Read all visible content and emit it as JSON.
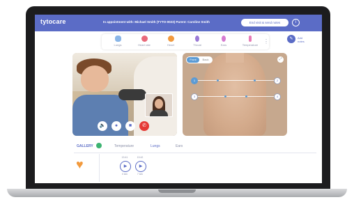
{
  "app": {
    "logo": "tytocare",
    "appointment_text": "In appointment with: Michael Smith (TYTO-0023)  Parent: Caroline Smith",
    "end_button": "End visit & send notes",
    "info_icon": "info-icon"
  },
  "toolbar": {
    "items": [
      {
        "label": "Lungs",
        "icon": "lungs-icon",
        "color": "#8ab6e8"
      },
      {
        "label": "Heart rate",
        "icon": "heart-rate-icon",
        "color": "#e8697a"
      },
      {
        "label": "Heart",
        "icon": "heart-icon",
        "color": "#f29a3d"
      },
      {
        "label": "Throat",
        "icon": "throat-icon",
        "color": "#9b7ad6"
      },
      {
        "label": "Ears",
        "icon": "ear-icon",
        "color": "#d67ad0"
      },
      {
        "label": "Temperature",
        "icon": "thermometer-icon",
        "color": "#e87ab6"
      }
    ],
    "add_notes": "Add notes"
  },
  "diagram": {
    "front": "Front",
    "back": "Back",
    "points": [
      "1",
      "2",
      "3",
      "4"
    ]
  },
  "tabs": {
    "gallery": "GALLERY",
    "items": [
      "Temperature",
      "Lungs",
      "Ears"
    ],
    "active": "Lungs"
  },
  "recordings": [
    {
      "time": "13:41",
      "duration": "0 sec"
    },
    {
      "time": "13:42",
      "duration": "7 sec"
    }
  ],
  "colors": {
    "brand": "#5b6cc6",
    "accent": "#5b9bd5",
    "end_call": "#e53935",
    "heart": "#f29a3d"
  }
}
